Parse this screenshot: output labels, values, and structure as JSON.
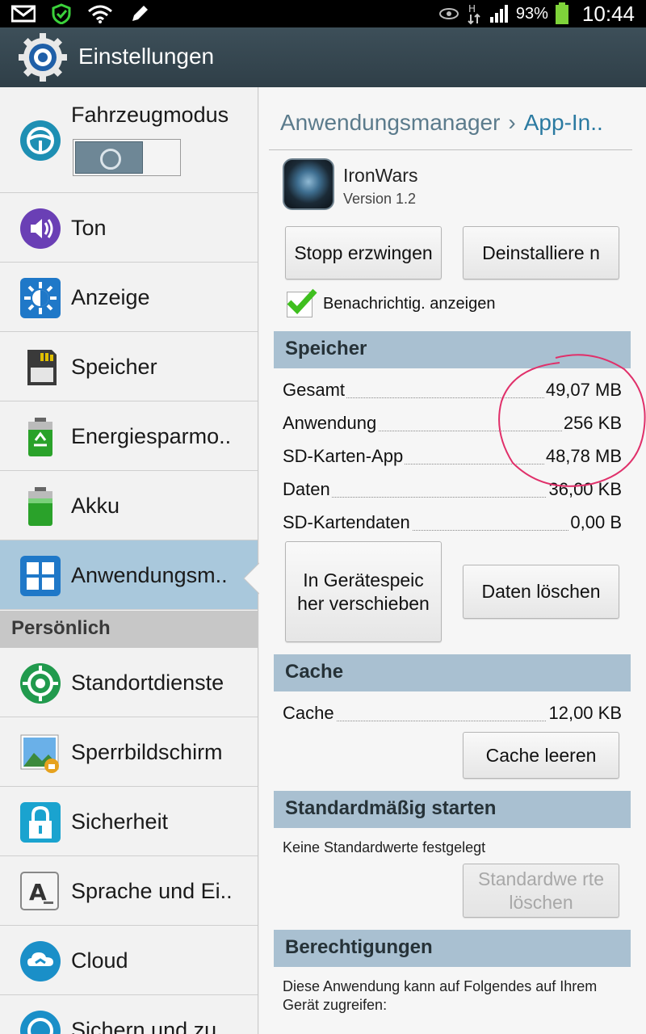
{
  "status_bar": {
    "battery_percent": "93%",
    "time": "10:44",
    "icons": [
      "gmail-icon",
      "shield-icon",
      "wifi-icon",
      "pencil-icon",
      "eye-icon",
      "data-transfer-icon",
      "signal-icon",
      "battery-icon"
    ]
  },
  "action_bar": {
    "title": "Einstellungen",
    "icon": "settings-gear-icon"
  },
  "left_menu": {
    "items": [
      {
        "label": "Fahrzeugmodus",
        "icon": "steering-wheel-icon"
      },
      {
        "label": "Ton",
        "icon": "speaker-icon"
      },
      {
        "label": "Anzeige",
        "icon": "brightness-icon"
      },
      {
        "label": "Speicher",
        "icon": "sd-card-icon"
      },
      {
        "label": "Energiesparmo..",
        "icon": "battery-recycle-icon"
      },
      {
        "label": "Akku",
        "icon": "battery-icon"
      },
      {
        "label": "Anwendungsm..",
        "icon": "apps-grid-icon",
        "selected": true
      }
    ],
    "section_header": "Persönlich",
    "items2": [
      {
        "label": "Standortdienste",
        "icon": "location-icon"
      },
      {
        "label": "Sperrbildschirm",
        "icon": "lockscreen-icon"
      },
      {
        "label": "Sicherheit",
        "icon": "lock-icon"
      },
      {
        "label": "Sprache und Ei..",
        "icon": "keyboard-letter-icon"
      },
      {
        "label": "Cloud",
        "icon": "cloud-icon"
      },
      {
        "label": "Sichern und zu..",
        "icon": "backup-icon"
      }
    ],
    "toggle_state": "off"
  },
  "detail": {
    "breadcrumb": {
      "parent": "Anwendungsmanager",
      "current": "App-In.."
    },
    "app_name": "IronWars",
    "app_version": "Version 1.2",
    "buttons": {
      "force_stop": "Stopp erzwingen",
      "uninstall": "Deinstalliere n",
      "move": "In Gerätespeic her verschieben",
      "clear_data": "Daten löschen",
      "clear_cache": "Cache leeren",
      "clear_defaults": "Standardwe rte löschen"
    },
    "notification_checkbox": {
      "label": "Benachrichtig. anzeigen",
      "checked": true
    },
    "storage": {
      "title": "Speicher",
      "rows": [
        {
          "label": "Gesamt",
          "value": "49,07 MB"
        },
        {
          "label": "Anwendung",
          "value": "256 KB"
        },
        {
          "label": "SD-Karten-App",
          "value": "48,78 MB"
        },
        {
          "label": "Daten",
          "value": "36,00 KB"
        },
        {
          "label": "SD-Kartendaten",
          "value": "0,00 B"
        }
      ]
    },
    "cache": {
      "title": "Cache",
      "row": {
        "label": "Cache",
        "value": "12,00 KB"
      }
    },
    "defaults": {
      "title": "Standardmäßig starten",
      "text": "Keine Standardwerte festgelegt"
    },
    "permissions": {
      "title": "Berechtigungen",
      "text": "Diese Anwendung kann auf Folgendes auf Ihrem Gerät zugreifen:"
    }
  },
  "colors": {
    "action_bar": "#34444d",
    "selected_item": "#a9c8dc",
    "section_bg": "#a9c0d1",
    "annotation": "#e0306a"
  }
}
